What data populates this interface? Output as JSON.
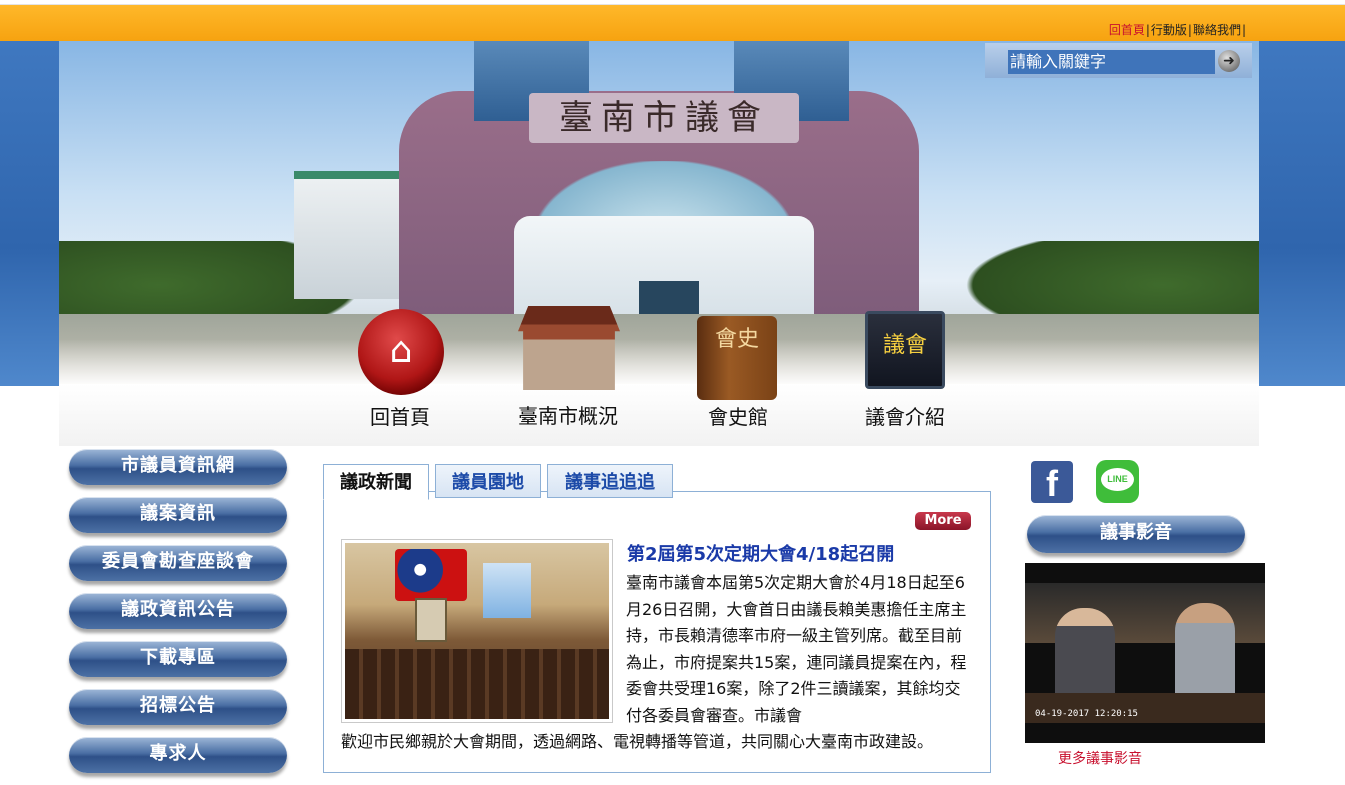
{
  "top_links": {
    "home": "回首頁",
    "mobile": "行動版",
    "contact": "聯絡我們",
    "separator": "|"
  },
  "search": {
    "placeholder": "請輸入關鍵字",
    "button_icon": "arrow-right-icon"
  },
  "banner": {
    "sign_text": "臺南市議會"
  },
  "main_nav": [
    {
      "label": "回首頁",
      "icon": "house-icon"
    },
    {
      "label": "臺南市概況",
      "icon": "temple-icon"
    },
    {
      "label": "會史館",
      "icon": "book-icon",
      "icon_text": "會史"
    },
    {
      "label": "議會介紹",
      "icon": "blackboard-icon",
      "icon_text": "議會"
    }
  ],
  "sidebar": {
    "items": [
      {
        "label": "市議員資訊網"
      },
      {
        "label": "議案資訊"
      },
      {
        "label": "委員會勘查座談會"
      },
      {
        "label": "議政資訊公告"
      },
      {
        "label": "下載專區"
      },
      {
        "label": "招標公告"
      },
      {
        "label": "專求人"
      }
    ]
  },
  "news_tabs": [
    {
      "label": "議政新聞",
      "active": true
    },
    {
      "label": "議員園地",
      "active": false
    },
    {
      "label": "議事追追追",
      "active": false
    }
  ],
  "news": {
    "more_label": "More",
    "title": "第2屆第5次定期大會4/18起召開",
    "body": "臺南市議會本屆第5次定期大會於4月18日起至6月26日召開，大會首日由議長賴美惠擔任主席主持，市長賴清德率市府一級主管列席。截至目前為止，市府提案共15案，連同議員提案在內，程委會共受理16案，除了2件三讀議案，其餘均交付各委員會審查。市議會",
    "body_cont": "歡迎市民鄉親於大會期間，透過網路、電視轉播等管道，共同關心大臺南市政建設。"
  },
  "social": {
    "facebook_icon": "facebook-icon",
    "line_icon": "line-icon",
    "line_text": "LINE"
  },
  "video_section": {
    "button_label": "議事影音",
    "timestamp": "04-19-2017 12:20:15",
    "caption": "更多議事影音"
  },
  "colors": {
    "top_bar": "#f6a20f",
    "side_bg": "#2f65ad",
    "link_accent": "#1a3aa8",
    "more_red": "#a0192f"
  }
}
